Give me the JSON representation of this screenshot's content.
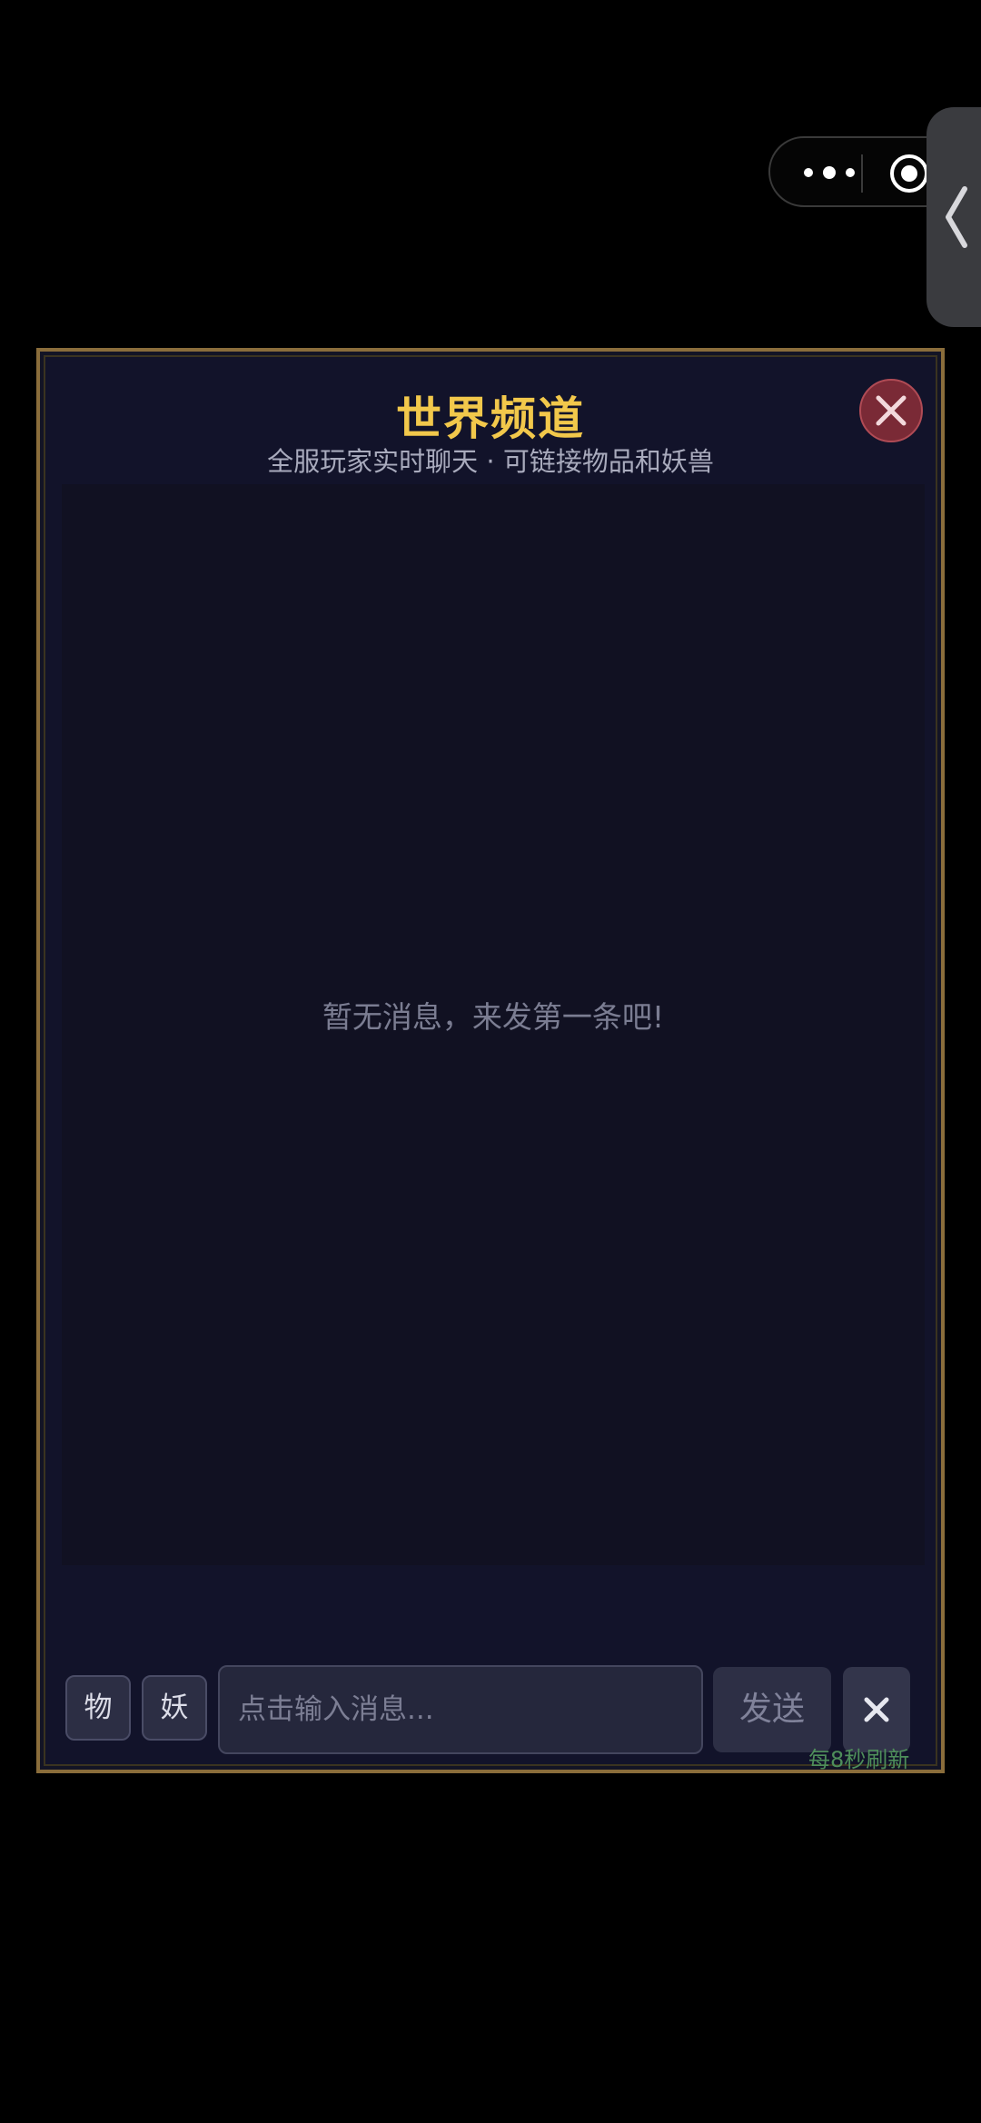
{
  "colors": {
    "title": "#f2c84b",
    "border_gold": "#8a6d3b",
    "close_red": "#7a2a36",
    "refresh_green": "#4e8e5a"
  },
  "capsule": {
    "more_icon": "more-dots-icon",
    "target_icon": "target-circle-icon"
  },
  "side_handle": {
    "icon": "chevron-left-icon"
  },
  "chat": {
    "title": "世界频道",
    "subtitle": "全服玩家实时聊天 · 可链接物品和妖兽",
    "close_icon": "close-icon",
    "empty_message": "暂无消息，来发第一条吧!"
  },
  "input_bar": {
    "tag_item_label": "物",
    "tag_beast_label": "妖",
    "input_placeholder": "点击输入消息...",
    "input_value": "",
    "send_label": "发送",
    "clear_icon": "close-icon",
    "refresh_note": "每8秒刷新"
  }
}
